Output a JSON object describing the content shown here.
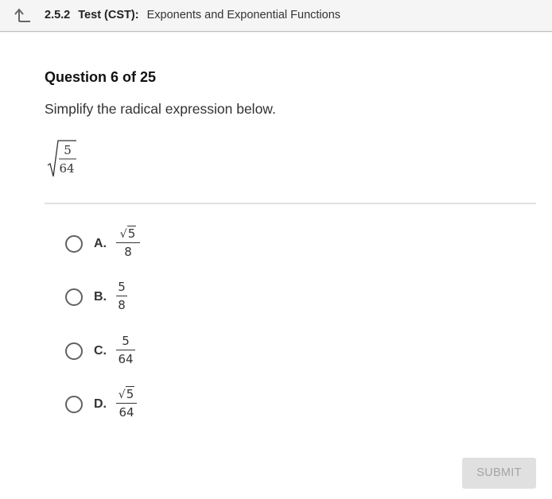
{
  "header": {
    "back_icon": "back-arrow-icon",
    "section_number": "2.5.2",
    "test_label": "Test (CST):",
    "test_title": "Exponents and Exponential Functions"
  },
  "question": {
    "number_label": "Question 6 of 25",
    "prompt": "Simplify the radical expression below.",
    "expression": {
      "type": "square-root-of-fraction",
      "numerator": "5",
      "denominator": "64"
    }
  },
  "options": [
    {
      "letter": "A.",
      "numerator": "5",
      "numerator_radical": true,
      "denominator": "8",
      "selected": false
    },
    {
      "letter": "B.",
      "numerator": "5",
      "numerator_radical": false,
      "denominator": "8",
      "selected": false
    },
    {
      "letter": "C.",
      "numerator": "5",
      "numerator_radical": false,
      "denominator": "64",
      "selected": false
    },
    {
      "letter": "D.",
      "numerator": "5",
      "numerator_radical": true,
      "denominator": "64",
      "selected": false
    }
  ],
  "submit": {
    "label": "SUBMIT",
    "enabled": false
  },
  "colors": {
    "header_bg": "#f5f5f5",
    "submit_bg": "#e0e0e0",
    "submit_text": "#a4a4a4",
    "radio_border": "#616161"
  }
}
